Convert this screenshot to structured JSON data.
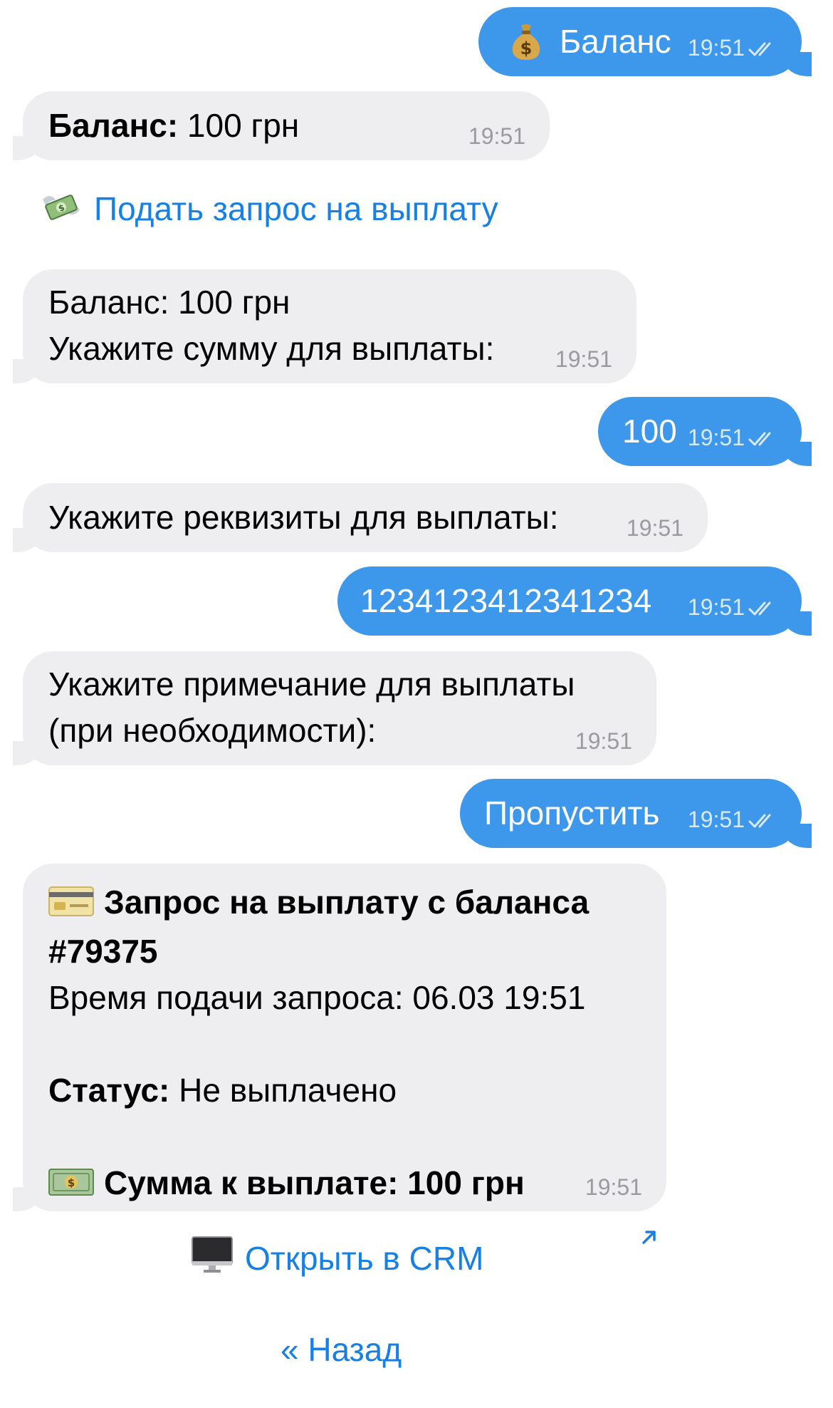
{
  "messages": {
    "m1": {
      "icon": "money-bag-icon",
      "text": "Баланс",
      "time": "19:51"
    },
    "m2": {
      "bold": "Баланс:",
      "text": " 100 грн",
      "time": "19:51"
    },
    "m3": {
      "line1": "Баланс: 100 грн",
      "line2": "Укажите сумму для выплаты:",
      "time": "19:51"
    },
    "m4": {
      "text": "100",
      "time": "19:51"
    },
    "m5": {
      "text": "Укажите реквизиты для выплаты:",
      "time": "19:51"
    },
    "m6": {
      "text": "1234123412341234",
      "time": "19:51"
    },
    "m7": {
      "line1": "Укажите примечание для выплаты",
      "line2": "(при необходимости):",
      "time": "19:51"
    },
    "m8": {
      "text": "Пропустить",
      "time": "19:51"
    },
    "m9": {
      "title_line1": "Запрос на выплату с баланса",
      "title_line2": "#79375",
      "submitted": "Время подачи запроса: 06.03 19:51",
      "status_label": "Статус:",
      "status_value": " Не выплачено",
      "amount": "Сумма к выплате: 100 грн",
      "time": "19:51"
    }
  },
  "buttons": {
    "payout_request": {
      "icon": "money-with-wings-icon",
      "label": "Подать запрос на выплату"
    },
    "open_crm": {
      "icon": "desktop-computer-icon",
      "label": "Открыть в CRM"
    },
    "back": {
      "label": "« Назад"
    }
  },
  "colors": {
    "outgoing": "#3d97ea",
    "incoming": "#eeeef0",
    "link": "#1680e6"
  }
}
